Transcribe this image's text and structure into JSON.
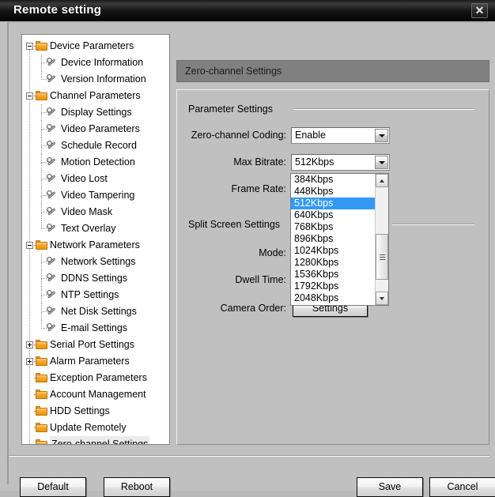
{
  "window": {
    "title": "Remote setting",
    "close_icon": "close-icon"
  },
  "tree": {
    "items": [
      {
        "label": "Device Parameters",
        "level": 0,
        "icon": "folder-icon",
        "expander": "minus",
        "selected": false
      },
      {
        "label": "Device Information",
        "level": 1,
        "icon": "wrench-icon",
        "expander": "none",
        "selected": false
      },
      {
        "label": "Version Information",
        "level": 1,
        "icon": "wrench-icon",
        "expander": "none",
        "selected": false
      },
      {
        "label": "Channel Parameters",
        "level": 0,
        "icon": "folder-icon",
        "expander": "minus",
        "selected": false
      },
      {
        "label": "Display Settings",
        "level": 1,
        "icon": "wrench-icon",
        "expander": "none",
        "selected": false
      },
      {
        "label": "Video Parameters",
        "level": 1,
        "icon": "wrench-icon",
        "expander": "none",
        "selected": false
      },
      {
        "label": "Schedule Record",
        "level": 1,
        "icon": "wrench-icon",
        "expander": "none",
        "selected": false
      },
      {
        "label": "Motion Detection",
        "level": 1,
        "icon": "wrench-icon",
        "expander": "none",
        "selected": false
      },
      {
        "label": "Video Lost",
        "level": 1,
        "icon": "wrench-icon",
        "expander": "none",
        "selected": false
      },
      {
        "label": "Video Tampering",
        "level": 1,
        "icon": "wrench-icon",
        "expander": "none",
        "selected": false
      },
      {
        "label": "Video Mask",
        "level": 1,
        "icon": "wrench-icon",
        "expander": "none",
        "selected": false
      },
      {
        "label": "Text Overlay",
        "level": 1,
        "icon": "wrench-icon",
        "expander": "none",
        "selected": false
      },
      {
        "label": "Network Parameters",
        "level": 0,
        "icon": "folder-icon",
        "expander": "minus",
        "selected": false
      },
      {
        "label": "Network Settings",
        "level": 1,
        "icon": "wrench-icon",
        "expander": "none",
        "selected": false
      },
      {
        "label": "DDNS Settings",
        "level": 1,
        "icon": "wrench-icon",
        "expander": "none",
        "selected": false
      },
      {
        "label": "NTP Settings",
        "level": 1,
        "icon": "wrench-icon",
        "expander": "none",
        "selected": false
      },
      {
        "label": "Net Disk Settings",
        "level": 1,
        "icon": "wrench-icon",
        "expander": "none",
        "selected": false
      },
      {
        "label": "E-mail Settings",
        "level": 1,
        "icon": "wrench-icon",
        "expander": "none",
        "selected": false
      },
      {
        "label": "Serial Port Settings",
        "level": 0,
        "icon": "folder-icon",
        "expander": "plus",
        "selected": false
      },
      {
        "label": "Alarm Parameters",
        "level": 0,
        "icon": "folder-icon",
        "expander": "plus",
        "selected": false
      },
      {
        "label": "Exception Parameters",
        "level": 0,
        "icon": "folder-icon",
        "expander": "none",
        "selected": false
      },
      {
        "label": "Account Management",
        "level": 0,
        "icon": "folder-icon",
        "expander": "none",
        "selected": false
      },
      {
        "label": "HDD Settings",
        "level": 0,
        "icon": "folder-icon",
        "expander": "none",
        "selected": false
      },
      {
        "label": "Update Remotely",
        "level": 0,
        "icon": "folder-icon",
        "expander": "none",
        "selected": false
      },
      {
        "label": "Zero-channel Settings",
        "level": 0,
        "icon": "folder-icon",
        "expander": "none",
        "selected": true
      }
    ]
  },
  "content": {
    "header": "Zero-channel Settings",
    "groups": {
      "parameter_settings": "Parameter Settings",
      "split_screen_settings": "Split Screen Settings"
    },
    "fields": {
      "zero_channel_coding": {
        "label": "Zero-channel Coding:",
        "value": "Enable"
      },
      "max_bitrate": {
        "label": "Max Bitrate:",
        "value": "512Kbps"
      },
      "frame_rate": {
        "label": "Frame Rate:",
        "value": ""
      },
      "mode": {
        "label": "Mode:",
        "value": ""
      },
      "dwell_time": {
        "label": "Dwell Time:",
        "value": ""
      },
      "camera_order": {
        "label": "Camera Order:",
        "value": ""
      }
    },
    "settings_button": "Settings"
  },
  "dropdown": {
    "open": true,
    "selected": "512Kbps",
    "options": [
      "384Kbps",
      "448Kbps",
      "512Kbps",
      "640Kbps",
      "768Kbps",
      "896Kbps",
      "1024Kbps",
      "1280Kbps",
      "1536Kbps",
      "1792Kbps",
      "2048Kbps"
    ],
    "scrollbar": {
      "up_icon": "scroll-up-icon",
      "down_icon": "scroll-down-icon"
    }
  },
  "footer": {
    "default": "Default",
    "reboot": "Reboot",
    "save": "Save",
    "cancel": "Cancel"
  },
  "colors": {
    "titlebar": "#141414",
    "header_bar": "#808080",
    "dialog_bg": "#c0c0c0",
    "selection_blue": "#3399f5",
    "folder_orange": "#f5a623"
  }
}
